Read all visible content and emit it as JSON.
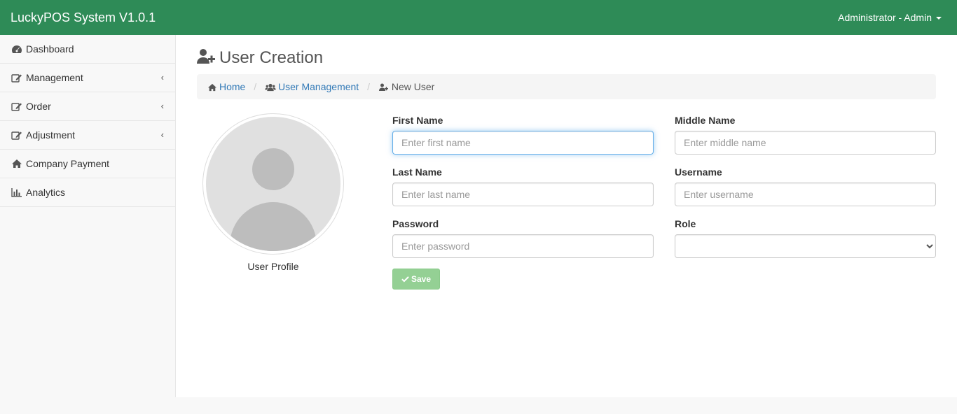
{
  "app": {
    "brand": "LuckyPOS System V1.0.1",
    "user_menu_label": "Administrator - Admin"
  },
  "sidebar": {
    "items": [
      {
        "label": "Dashboard",
        "icon": "dashboard-icon"
      },
      {
        "label": "Management",
        "icon": "edit-icon",
        "chevron": "‹"
      },
      {
        "label": "Order",
        "icon": "edit-icon",
        "chevron": "‹"
      },
      {
        "label": "Adjustment",
        "icon": "edit-icon",
        "chevron": "‹"
      },
      {
        "label": "Company Payment",
        "icon": "home-icon"
      },
      {
        "label": "Analytics",
        "icon": "bar-chart-icon"
      }
    ]
  },
  "page": {
    "title": "User Creation",
    "breadcrumb": {
      "home": "Home",
      "separator": "/",
      "user_management": "User Management",
      "current": "New User"
    }
  },
  "profile": {
    "caption": "User Profile"
  },
  "form": {
    "first_name": {
      "label": "First Name",
      "placeholder": "Enter first name",
      "value": ""
    },
    "middle_name": {
      "label": "Middle Name",
      "placeholder": "Enter middle name",
      "value": ""
    },
    "last_name": {
      "label": "Last Name",
      "placeholder": "Enter last name",
      "value": ""
    },
    "username": {
      "label": "Username",
      "placeholder": "Enter username",
      "value": ""
    },
    "password": {
      "label": "Password",
      "placeholder": "Enter password",
      "value": ""
    },
    "role": {
      "label": "Role",
      "selected": ""
    },
    "save_label": "Save"
  },
  "colors": {
    "header_bg": "#2e8b57",
    "link": "#337ab7",
    "save_button": "#5cb85c"
  }
}
